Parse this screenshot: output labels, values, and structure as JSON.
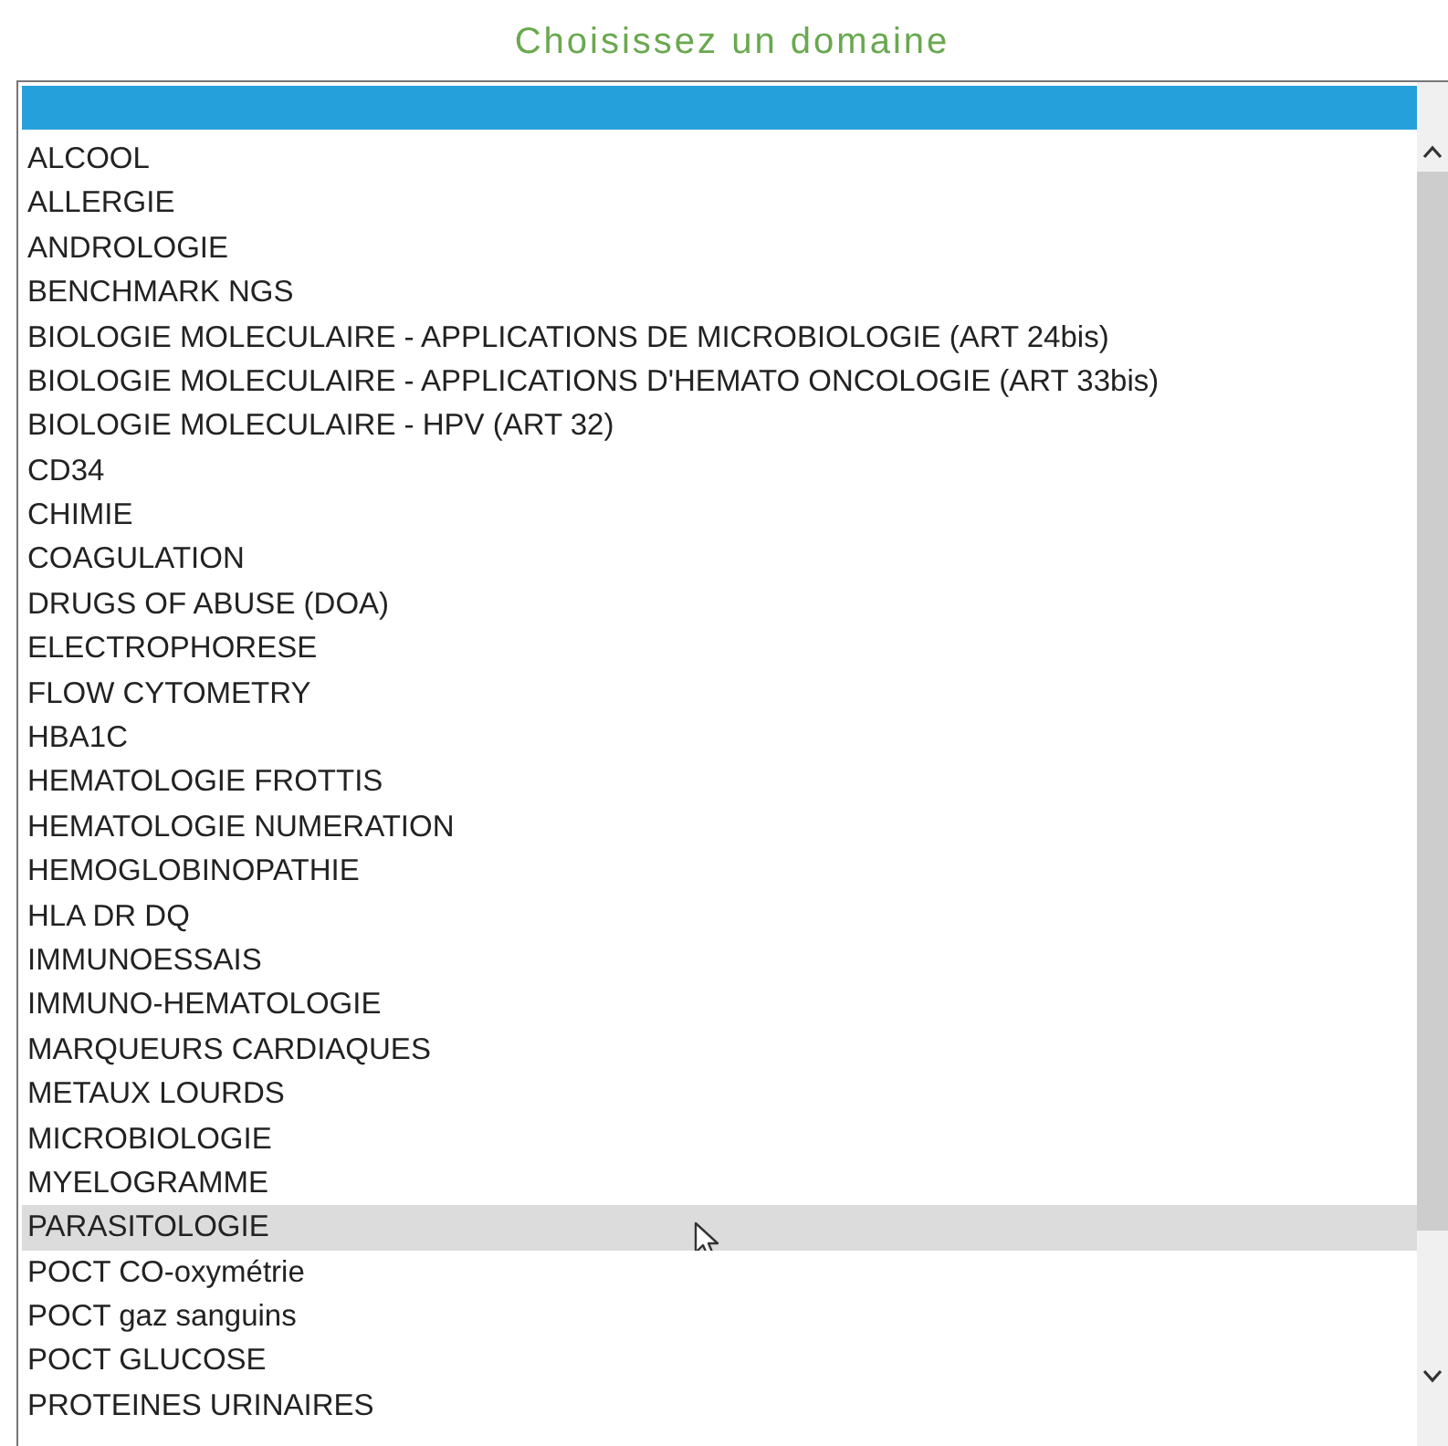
{
  "title": "Choisissez un domaine",
  "blank_option": {
    "selected": true
  },
  "options": [
    {
      "label": "ALCOOL",
      "selected": false,
      "hovered": false
    },
    {
      "label": "ALLERGIE",
      "selected": false,
      "hovered": false
    },
    {
      "label": "ANDROLOGIE",
      "selected": false,
      "hovered": false
    },
    {
      "label": "BENCHMARK NGS",
      "selected": false,
      "hovered": false
    },
    {
      "label": "BIOLOGIE MOLECULAIRE - APPLICATIONS DE MICROBIOLOGIE (ART 24bis)",
      "selected": false,
      "hovered": false
    },
    {
      "label": "BIOLOGIE MOLECULAIRE - APPLICATIONS D'HEMATO ONCOLOGIE (ART 33bis)",
      "selected": false,
      "hovered": false
    },
    {
      "label": "BIOLOGIE MOLECULAIRE - HPV (ART 32)",
      "selected": false,
      "hovered": false
    },
    {
      "label": "CD34",
      "selected": false,
      "hovered": false
    },
    {
      "label": "CHIMIE",
      "selected": false,
      "hovered": false
    },
    {
      "label": "COAGULATION",
      "selected": false,
      "hovered": false
    },
    {
      "label": "DRUGS OF ABUSE (DOA)",
      "selected": false,
      "hovered": false
    },
    {
      "label": "ELECTROPHORESE",
      "selected": false,
      "hovered": false
    },
    {
      "label": "FLOW CYTOMETRY",
      "selected": false,
      "hovered": false
    },
    {
      "label": "HBA1C",
      "selected": false,
      "hovered": false
    },
    {
      "label": "HEMATOLOGIE FROTTIS",
      "selected": false,
      "hovered": false
    },
    {
      "label": "HEMATOLOGIE NUMERATION",
      "selected": false,
      "hovered": false
    },
    {
      "label": "HEMOGLOBINOPATHIE",
      "selected": false,
      "hovered": false
    },
    {
      "label": "HLA DR DQ",
      "selected": false,
      "hovered": false
    },
    {
      "label": "IMMUNOESSAIS",
      "selected": false,
      "hovered": false
    },
    {
      "label": "IMMUNO-HEMATOLOGIE",
      "selected": false,
      "hovered": false
    },
    {
      "label": "MARQUEURS CARDIAQUES",
      "selected": false,
      "hovered": false
    },
    {
      "label": "METAUX LOURDS",
      "selected": false,
      "hovered": false
    },
    {
      "label": "MICROBIOLOGIE",
      "selected": false,
      "hovered": false
    },
    {
      "label": "MYELOGRAMME",
      "selected": false,
      "hovered": false
    },
    {
      "label": "PARASITOLOGIE",
      "selected": false,
      "hovered": true
    },
    {
      "label": "POCT CO-oxymétrie",
      "selected": false,
      "hovered": false
    },
    {
      "label": "POCT gaz sanguins",
      "selected": false,
      "hovered": false
    },
    {
      "label": "POCT GLUCOSE",
      "selected": false,
      "hovered": false
    },
    {
      "label": "PROTEINES URINAIRES",
      "selected": false,
      "hovered": false
    }
  ]
}
